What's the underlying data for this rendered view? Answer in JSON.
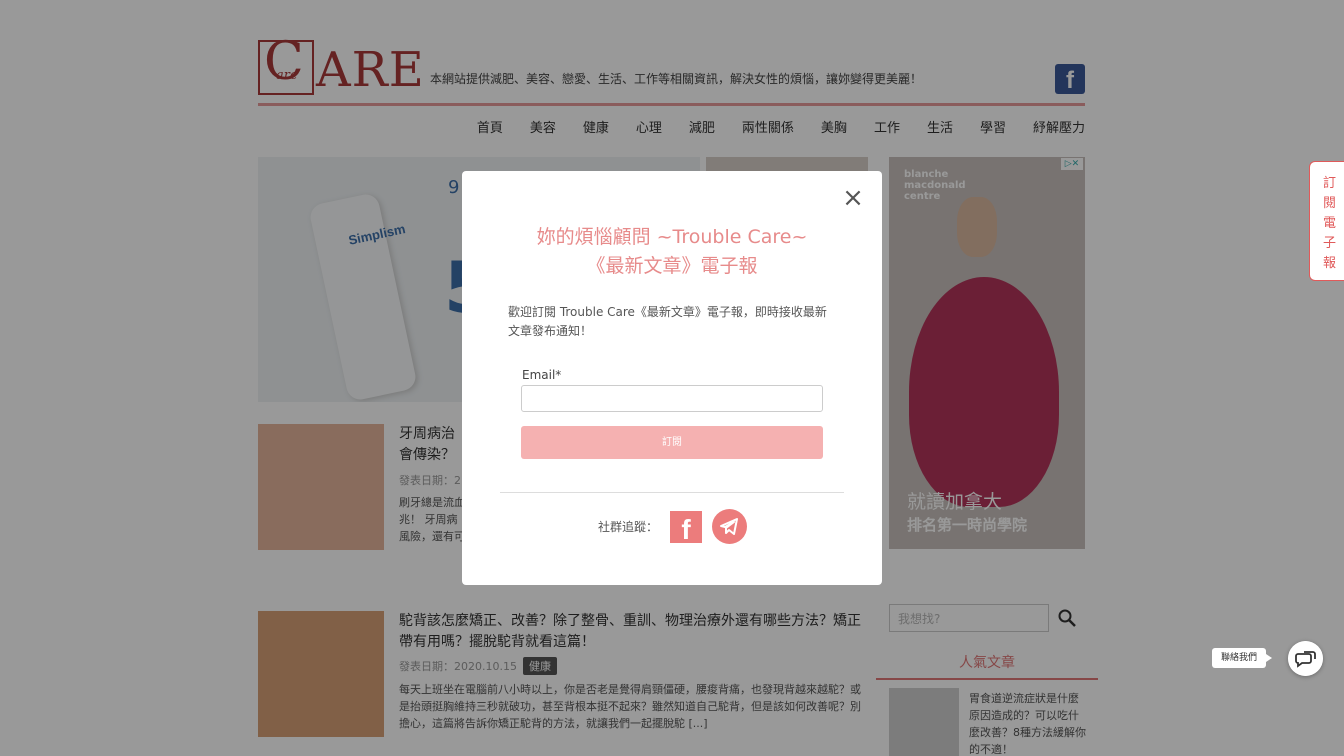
{
  "header": {
    "logo_small": "are",
    "logo_big": "C",
    "logo_rest": "ARE",
    "tagline": "本網站提供減肥、美容、戀愛、生活、工作等相關資訊，解決女性的煩惱，讓妳變得更美麗！",
    "fb_letter": "f"
  },
  "nav": [
    "首頁",
    "美容",
    "健康",
    "心理",
    "減肥",
    "兩性關係",
    "美胸",
    "工作",
    "生活",
    "學習",
    "紓解壓力"
  ],
  "hero": {
    "brand": "Simplism",
    "num": "9",
    "big": "5"
  },
  "ad": {
    "brand": "blanche\nmacdonald\ncentre",
    "line1": "就讀加拿大",
    "line2": "排名第一時尚學院"
  },
  "articles": [
    {
      "title": "牙周病治\n會傳染？",
      "meta": "發表日期：2",
      "excerpt": "刷牙總是流血\n兆！ 牙周病\n風險，還有可"
    },
    {
      "title": "駝背該怎麼矯正、改善？除了整骨、重訓、物理治療外還有哪些方法？矯正帶有用嗎？擺脫駝背就看這篇！",
      "meta": "發表日期：2020.10.15",
      "tag": "健康",
      "excerpt": "每天上班坐在電腦前八小時以上，你是否老是覺得肩頸僵硬，腰痠背痛，也發現背越來越駝？或是抬頭挺胸維持三秒就破功，甚至背根本挺不起來？雖然知道自己駝背，但是該如何改善呢？別擔心，這篇將告訴你矯正駝背的方法，就讓我們一起擺脫駝 [...]"
    }
  ],
  "sidebar": {
    "search_placeholder": "我想找?",
    "popular_title": "人氣文章",
    "popular_text": "胃食道逆流症狀是什麼原因造成的？可以吃什麼改善？8種方法緩解你的不適！"
  },
  "modal": {
    "title_line1": "妳的煩惱顧問 ~Trouble Care~",
    "title_line2": "《最新文章》電子報",
    "desc": "歡迎訂閱 Trouble Care《最新文章》電子報，即時接收最新文章發布通知！",
    "email_label": "Email*",
    "email_value": "",
    "subscribe_label": "訂閱",
    "social_label": "社群追蹤：",
    "fb_letter": "f"
  },
  "side_tab": {
    "label": "訂閱電子報"
  },
  "contact": {
    "label": "聯絡我們"
  },
  "colors": {
    "brand": "#a83a3a",
    "accent": "#e78b8b",
    "button": "#f5b1b1"
  }
}
